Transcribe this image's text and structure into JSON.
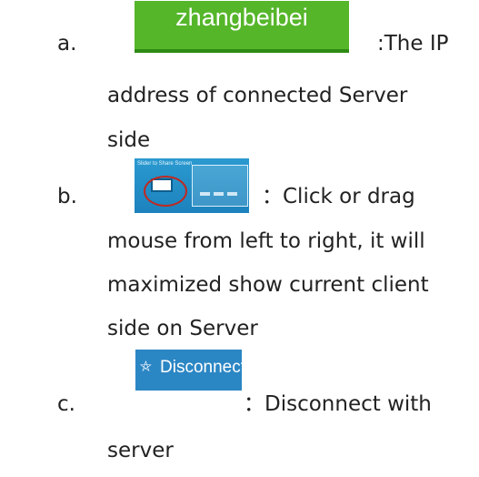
{
  "items": [
    {
      "letter": "a.",
      "badge_text": "zhangbeibei",
      "text_line1": ":The IP",
      "text_line2": "address of connected Server",
      "text_line3": "side"
    },
    {
      "letter": "b.",
      "thumbnail_caption": "Slider to Share Screen",
      "text_line1": "：Click or drag",
      "text_line2": "mouse from left to right, it will",
      "text_line3": "maximized show current client",
      "text_line4": "side on Server"
    },
    {
      "letter": "c.",
      "button_label": "Disconnect",
      "text_line1": "：Disconnect with",
      "text_line2": "server"
    }
  ],
  "colors": {
    "badge_green": "#55b62a",
    "slider_blue": "#1f8ac7",
    "highlight_red": "#c0281f",
    "button_blue": "#2b86c4"
  },
  "icons": [
    "monitor-icon",
    "plug-icon"
  ]
}
